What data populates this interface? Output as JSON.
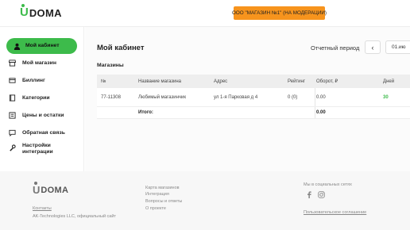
{
  "header": {
    "logo_mark": "U",
    "logo_text": "DOMA",
    "store_button": "ООО \"МАГАЗИН №1\" (НА МОДЕРАЦИИ)"
  },
  "sidebar": {
    "items": [
      {
        "label": "Мой кабинет",
        "icon": "user-icon",
        "active": true
      },
      {
        "label": "Мой магазин",
        "icon": "store-icon",
        "active": false
      },
      {
        "label": "Биллинг",
        "icon": "billing-icon",
        "active": false
      },
      {
        "label": "Категории",
        "icon": "book-icon",
        "active": false
      },
      {
        "label": "Цены и остатки",
        "icon": "list-icon",
        "active": false
      },
      {
        "label": "Обратная связь",
        "icon": "chat-icon",
        "active": false
      },
      {
        "label_line1": "Настройки",
        "label_line2": "интеграции",
        "icon": "wrench-icon",
        "active": false
      }
    ]
  },
  "main": {
    "title": "Мой кабинет",
    "period_label": "Отчетный период",
    "period_date": "01.ию",
    "section_title": "Магазины",
    "table": {
      "headers": {
        "num": "№",
        "name": "Название магазина",
        "address": "Адрес",
        "rating": "Рейтинг",
        "turnover": "Оборот, ₽",
        "days": "Дней"
      },
      "rows": [
        {
          "num": "77-11308",
          "name": "Любимый магазинчик",
          "address": "ул 1-я Парковая д 4",
          "rating": "0 (0)",
          "turnover": "0.00",
          "days": "30"
        }
      ],
      "total_label": "Итого:",
      "total_turnover": "0.00"
    }
  },
  "footer": {
    "logo_mark": "U",
    "logo_text": "DOMA",
    "contacts": "Контакты",
    "company": "AK-Technologies LLC, официальный сайт",
    "links": [
      "Карта магазинов",
      "Интеграция",
      "Вопросы и ответы",
      "О проекте"
    ],
    "social_title": "Мы в социальных сетях",
    "agreement": "Пользовательское соглашение"
  },
  "colors": {
    "accent": "#3dbb4b",
    "store_button": "#f7941d"
  }
}
